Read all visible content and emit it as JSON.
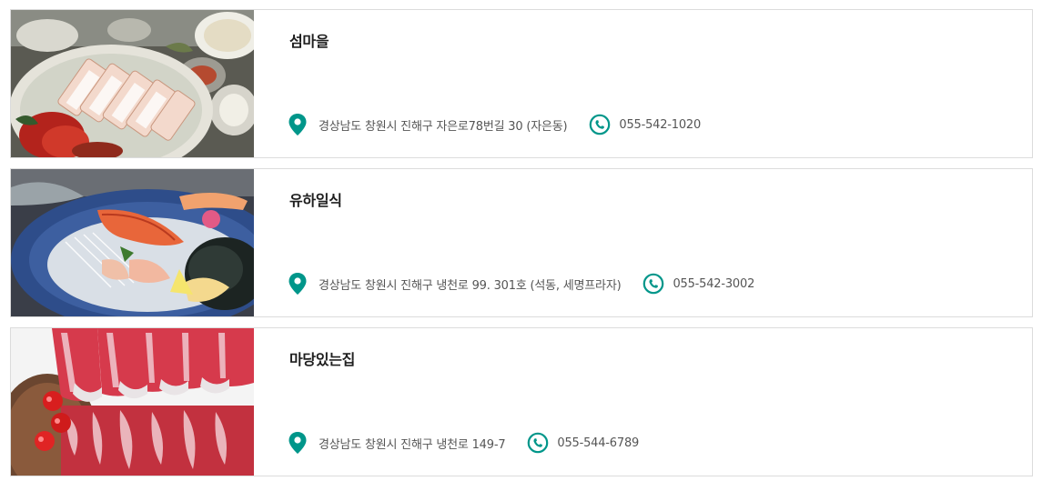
{
  "accent_color": "#00968a",
  "restaurants": [
    {
      "name": "섬마을",
      "address": "경상남도 창원시 진해구 자은로78번길 30 (자은동)",
      "phone": "055-542-1020",
      "image": "boiled-pork-bossam-photo"
    },
    {
      "name": "유하일식",
      "address": "경상남도 창원시 진해구 냉천로 99. 301호 (석동, 세명프라자)",
      "phone": "055-542-3002",
      "image": "sashimi-platter-photo"
    },
    {
      "name": "마당있는집",
      "address": "경상남도 창원시 진해구 냉천로 149-7",
      "phone": "055-544-6789",
      "image": "marbled-beef-photo"
    }
  ]
}
